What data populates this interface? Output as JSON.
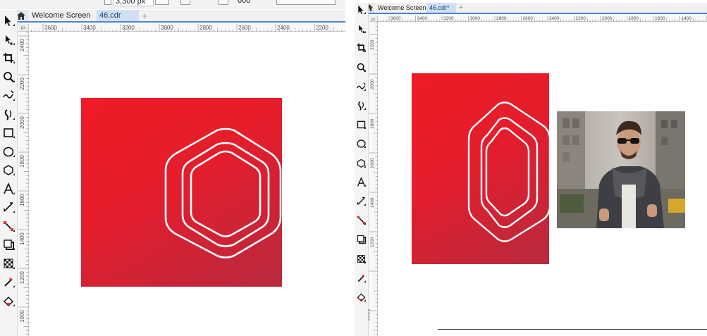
{
  "left": {
    "propbar": {
      "size_value": "3,300 px",
      "extra_value": "000"
    },
    "tabs": [
      {
        "label": "Welcome Screen"
      },
      {
        "label": "46.cdr"
      }
    ],
    "hruler_ticks": [
      "3600",
      "3400",
      "3200",
      "3000",
      "2800",
      "2600",
      "2400",
      "2200"
    ],
    "vruler_ticks": [
      "2400",
      "2200",
      "2000",
      "1800",
      "1600",
      "1400",
      "1200",
      "1000"
    ],
    "ruler_corner": "px"
  },
  "right": {
    "tabs": [
      {
        "label": "Welcome Screen"
      },
      {
        "label": "46.cdr*"
      }
    ],
    "hruler_ticks": [
      "3600",
      "3400",
      "3200",
      "3000",
      "2800",
      "2600",
      "2400",
      "2200",
      "2000",
      "1800",
      "1600",
      "1400"
    ],
    "vruler_ticks": [
      "2200",
      "2000",
      "1800",
      "1600",
      "1400",
      "1200"
    ],
    "ruler_corner": "px"
  },
  "colors": {
    "accent": "#4a86c8",
    "design_red": "#ee1c25",
    "design_dark": "#b82a3f",
    "outline": "#ffffff"
  },
  "tools": [
    "pick-tool-icon",
    "shape-tool-icon",
    "crop-tool-icon",
    "zoom-tool-icon",
    "freehand-tool-icon",
    "artistic-media-icon",
    "rectangle-tool-icon",
    "ellipse-tool-icon",
    "polygon-tool-icon",
    "text-tool-icon",
    "parallel-dimension-icon",
    "connector-tool-icon",
    "drop-shadow-icon",
    "transparency-icon",
    "eyedropper-icon",
    "interactive-fill-icon"
  ]
}
